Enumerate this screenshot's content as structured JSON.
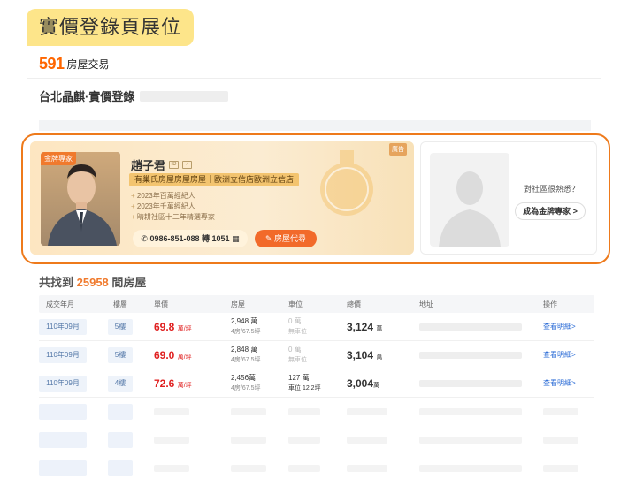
{
  "section_tag": "實價登錄頁展位",
  "logo": {
    "number": "591",
    "text": "房屋交易"
  },
  "breadcrumb": "台北晶麒·實價登錄",
  "agent": {
    "ribbon": "金牌專家",
    "corner_badge": "廣告",
    "name": "趙子君",
    "company": "有巢氏房屋房屋房屋｜歐洲立信店歐洲立信店",
    "honors": [
      "2023年百萬經紀人",
      "2023年千萬經紀人",
      "晴耕社區十二年精選專家"
    ],
    "phone": "0986-851-088 轉 1051",
    "rent_button": "房屋代尋"
  },
  "expert": {
    "question": "對社區很熟悉？",
    "button": "成為金牌專家 >"
  },
  "result": {
    "prefix": "共找到",
    "count": "25958",
    "suffix": "間房屋"
  },
  "table": {
    "headers": [
      "成交年月",
      "樓層",
      "單價",
      "房屋",
      "車位",
      "總價",
      "地址",
      "操作"
    ],
    "rows": [
      {
        "date": "110年09月",
        "floor": "5樓",
        "price": "69.8",
        "price_unit": "萬/坪",
        "house": "2,948 萬",
        "house_sub": "4房/67.5坪",
        "park": "0 萬",
        "park_sub": "無車位",
        "park_empty": true,
        "total": "3,124",
        "total_unit": "萬",
        "action": "查看明細>"
      },
      {
        "date": "110年09月",
        "floor": "5樓",
        "price": "69.0",
        "price_unit": "萬/坪",
        "house": "2,848 萬",
        "house_sub": "4房/67.5坪",
        "park": "0 萬",
        "park_sub": "無車位",
        "park_empty": true,
        "total": "3,104",
        "total_unit": "萬",
        "action": "查看明細>"
      },
      {
        "date": "110年09月",
        "floor": "4樓",
        "price": "72.6",
        "price_unit": "萬/坪",
        "house": "2,456萬",
        "house_sub": "4房/67.5坪",
        "park": "127 萬",
        "park_sub": "車位 12.2坪",
        "park_empty": false,
        "total": "3,004",
        "total_unit": "萬",
        "action": "查看明細>"
      }
    ]
  },
  "colors": {
    "accent": "#f07a2d",
    "highlight_border": "#ee7a1b",
    "price": "#e02020",
    "link": "#2a6bd6"
  }
}
